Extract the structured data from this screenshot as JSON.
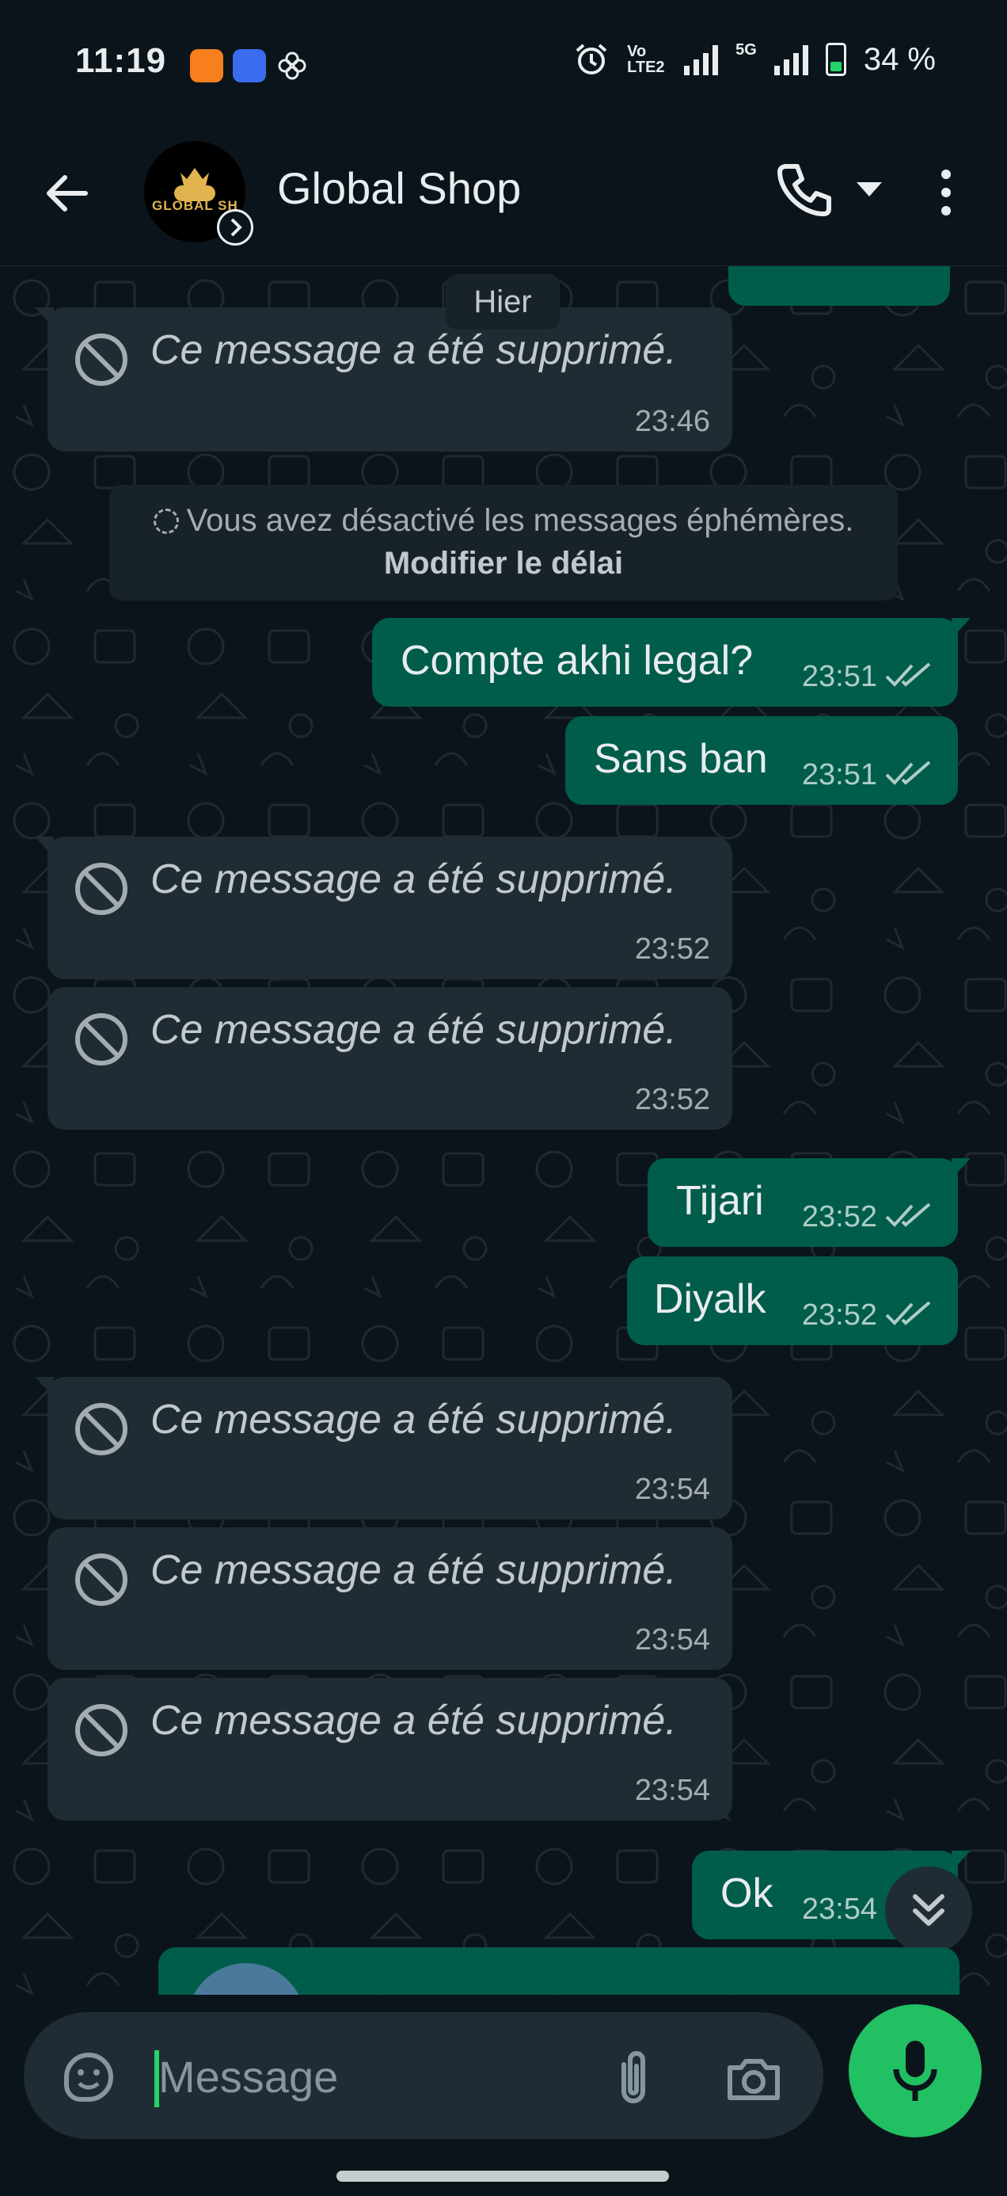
{
  "status_bar": {
    "time": "11:19",
    "volte": "Vo LTE2",
    "network": "5G",
    "battery": "34 %",
    "battery_level": 0.34
  },
  "header": {
    "contact_name": "Global Shop",
    "avatar_label": "GLOBAL SH"
  },
  "chat": {
    "date_chip": "Hier",
    "system_notice": {
      "text": "Vous avez désactivé les messages éphémères.",
      "link": "Modifier le délai"
    },
    "messages": [
      {
        "dir": "in",
        "deleted": true,
        "text": "Ce message a été supprimé.",
        "time": "23:46"
      },
      {
        "dir": "out",
        "text": "Compte akhi legal?",
        "time": "23:51"
      },
      {
        "dir": "out",
        "text": "Sans ban",
        "time": "23:51"
      },
      {
        "dir": "in",
        "deleted": true,
        "text": "Ce message a été supprimé.",
        "time": "23:52"
      },
      {
        "dir": "in",
        "deleted": true,
        "text": "Ce message a été supprimé.",
        "time": "23:52"
      },
      {
        "dir": "out",
        "text": "Tijari",
        "time": "23:52"
      },
      {
        "dir": "out",
        "text": "Diyalk",
        "time": "23:52"
      },
      {
        "dir": "in",
        "deleted": true,
        "text": "Ce message a été supprimé.",
        "time": "23:54"
      },
      {
        "dir": "in",
        "deleted": true,
        "text": "Ce message a été supprimé.",
        "time": "23:54"
      },
      {
        "dir": "in",
        "deleted": true,
        "text": "Ce message a été supprimé.",
        "time": "23:54"
      },
      {
        "dir": "out",
        "text": "Ok",
        "time": "23:54"
      }
    ]
  },
  "composer": {
    "placeholder": "Message"
  },
  "colors": {
    "background": "#0b141a",
    "incoming_bubble": "#202c33",
    "outgoing_bubble": "#005c4b",
    "accent": "#21c063",
    "read_ticks": "#aecdc6"
  }
}
